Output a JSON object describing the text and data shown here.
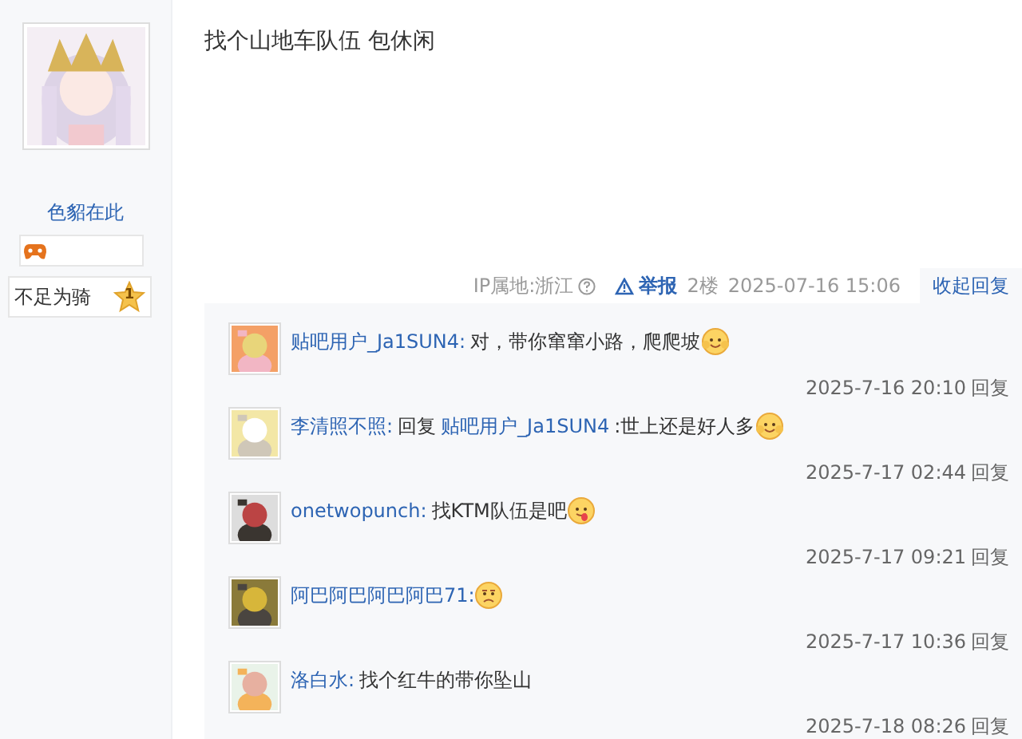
{
  "author": {
    "name": "色貂在此",
    "level": {
      "title": "不足为骑",
      "number": "1"
    }
  },
  "post": {
    "content": "找个山地车队伍 包休闲",
    "ip": "IP属地:浙江",
    "report": "举报",
    "floor": "2楼",
    "time": "2025-07-16 15:06",
    "toggle": "收起回复"
  },
  "comments": [
    {
      "user": "贴吧用户_Ja1SUN4:",
      "text": "对，带你窜窜小路，爬爬坡",
      "emoji": {
        "kind": "smile"
      },
      "time": "2025-7-16 20:10",
      "action": "回复"
    },
    {
      "user": "李清照不照:",
      "reply_label": "回复",
      "reply_to": "贴吧用户_Ja1SUN4",
      "text": ":世上还是好人多",
      "emoji": {
        "kind": "smile"
      },
      "time": "2025-7-17 02:44",
      "action": "回复"
    },
    {
      "user": "onetwopunch:",
      "text": "找KTM队伍是吧",
      "emoji": {
        "kind": "tongue"
      },
      "time": "2025-7-17 09:21",
      "action": "回复"
    },
    {
      "user": "阿巴阿巴阿巴阿巴71:",
      "emoji": {
        "kind": "frown"
      },
      "time": "2025-7-17 10:36",
      "action": "回复"
    },
    {
      "user": "洛白水:",
      "text": "找个红牛的带你坠山",
      "time": "2025-7-18 08:26",
      "action": "回复"
    }
  ]
}
